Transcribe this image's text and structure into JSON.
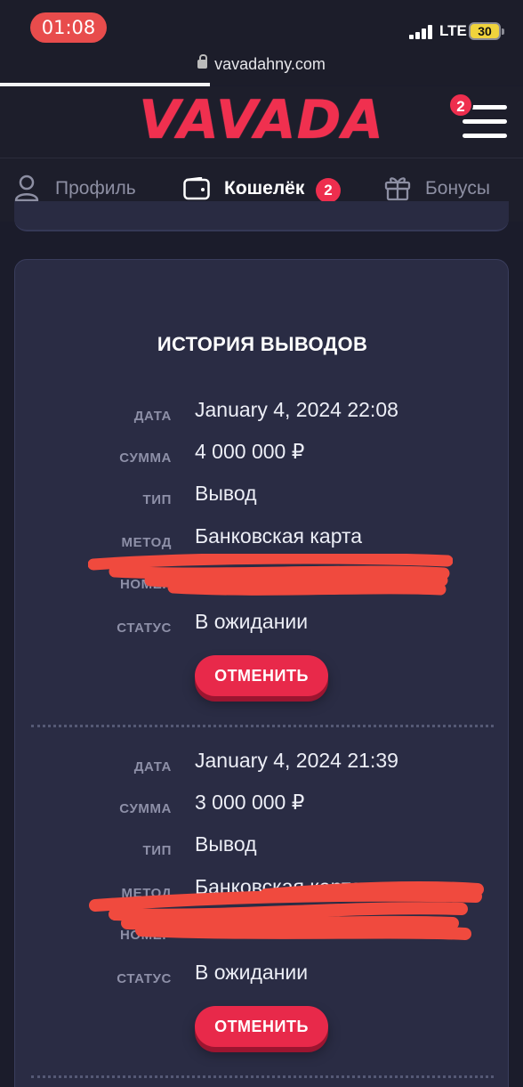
{
  "status_bar": {
    "time": "01:08",
    "network": "LTE",
    "battery": "30"
  },
  "browser": {
    "url": "vavadahny.com"
  },
  "header": {
    "logo": "VAVADA",
    "menu_badge": "2"
  },
  "tabs": [
    {
      "label": "Профиль",
      "icon": "user-icon",
      "active": false
    },
    {
      "label": "Кошелёк",
      "icon": "wallet-icon",
      "active": true,
      "badge": "2"
    },
    {
      "label": "Бонусы",
      "icon": "gift-icon",
      "active": false
    }
  ],
  "history": {
    "title": "ИСТОРИЯ ВЫВОДОВ",
    "labels": {
      "date": "ДАТА",
      "amount": "СУММА",
      "type": "ТИП",
      "method": "МЕТОД",
      "number": "НОМЕР",
      "status": "СТАТУС"
    },
    "cancel_label": "ОТМЕНИТЬ",
    "records": [
      {
        "date": "January 4, 2024 22:08",
        "amount": "4 000 000 ₽",
        "type": "Вывод",
        "method": "Банковская карта",
        "status": "В ожидании"
      },
      {
        "date": "January 4, 2024 21:39",
        "amount": "3 000 000 ₽",
        "type": "Вывод",
        "method": "Банковская карта",
        "status": "В ожидании"
      }
    ]
  },
  "colors": {
    "accent": "#ee2e4e",
    "card": "#2a2c44",
    "background": "#1b1c2b",
    "redaction": "#f04a3e"
  }
}
